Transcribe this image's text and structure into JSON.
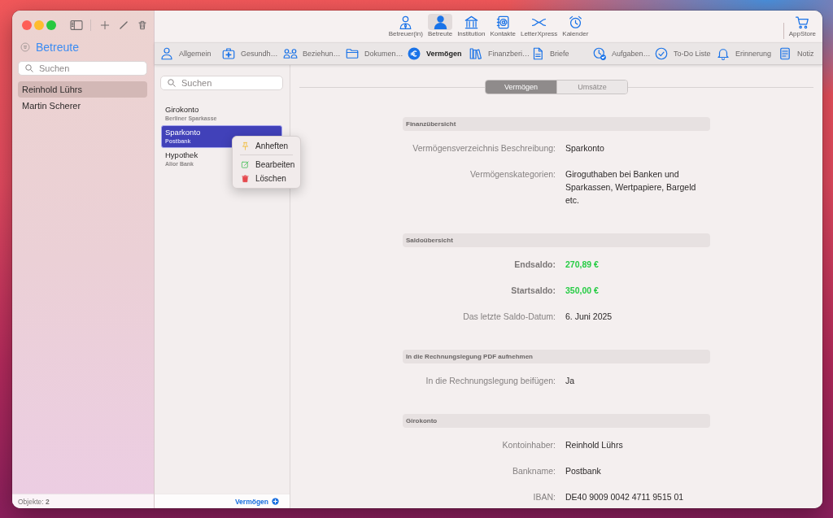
{
  "sidebar": {
    "title": "Betreute",
    "search": {
      "placeholder": "Suchen"
    },
    "items": [
      {
        "label": "Reinhold Lührs",
        "selected": true
      },
      {
        "label": "Martin Scherer",
        "selected": false
      }
    ],
    "footer": "Objekte: **2**"
  },
  "toolbar": {
    "items": [
      {
        "label": "Betreuer(in)",
        "selected": false
      },
      {
        "label": "Betreute",
        "selected": true
      },
      {
        "label": "Institution",
        "selected": false
      },
      {
        "label": "Kontakte",
        "selected": false
      },
      {
        "label": "LetterXpress",
        "selected": false
      },
      {
        "label": "Kalender",
        "selected": false
      }
    ],
    "store": {
      "label": "AppStore"
    }
  },
  "tabs": [
    {
      "label": "Allgemein",
      "selected": false
    },
    {
      "label": "Gesundh…",
      "selected": false
    },
    {
      "label": "Beziehun…",
      "selected": false
    },
    {
      "label": "Dokumen…",
      "selected": false
    },
    {
      "label": "Vermögen",
      "selected": true
    },
    {
      "label": "Finanzberi…",
      "selected": false
    },
    {
      "label": "Briefe",
      "selected": false
    },
    {
      "label": "Aufgaben…",
      "selected": false
    },
    {
      "label": "To-Do Liste",
      "selected": false
    },
    {
      "label": "Erinnerung",
      "selected": false
    },
    {
      "label": "Notiz",
      "selected": false
    }
  ],
  "list": {
    "search": {
      "placeholder": "Suchen"
    },
    "items": [
      {
        "title": "Girokonto",
        "subtitle": "Berliner Sparkasse",
        "selected": false
      },
      {
        "title": "Sparkonto",
        "subtitle": "Postbank",
        "selected": true
      },
      {
        "title": "Hypothek",
        "subtitle": "Alior Bank",
        "selected": false
      }
    ],
    "footer_button": "Vermögen"
  },
  "context_menu": {
    "items": [
      {
        "label": "Anheften",
        "separator_after": true
      },
      {
        "label": "Bearbeiten",
        "separator_after": false
      },
      {
        "label": "Löschen",
        "separator_after": false
      }
    ]
  },
  "segments": [
    {
      "label": "Vermögen",
      "selected": true
    },
    {
      "label": "Umsätze",
      "selected": false
    }
  ],
  "sections": [
    {
      "title": "Finanzübersicht",
      "rows": [
        {
          "label": "Vermögensverzeichnis Beschreibung:",
          "value": "Sparkonto",
          "kind": "text"
        },
        {
          "label": "Vermögenskategorien:",
          "value": "Giroguthaben bei Banken und Sparkassen, Wertpapiere, Bargeld etc.",
          "kind": "text"
        }
      ]
    },
    {
      "title": "Saldoübersicht",
      "rows": [
        {
          "label": "Endsaldo:",
          "value": "270,89 €",
          "kind": "amount"
        },
        {
          "label": "Startsaldo:",
          "value": "350,00 €",
          "kind": "amount"
        },
        {
          "label": "Das letzte Saldo-Datum:",
          "value": "6. Juni 2025",
          "kind": "text"
        }
      ]
    },
    {
      "title": "In die Rechnungslegung PDF aufnehmen",
      "rows": [
        {
          "label": "In die Rechnungslegung beifügen:",
          "value": "Ja",
          "kind": "text"
        }
      ]
    },
    {
      "title": "Girokonto",
      "rows": [
        {
          "label": "Kontoinhaber:",
          "value": "Reinhold Lührs",
          "kind": "text"
        },
        {
          "label": "Bankname:",
          "value": "Postbank",
          "kind": "text"
        },
        {
          "label": "IBAN:",
          "value": "DE40 9009 0042 4711 9515 01",
          "kind": "text"
        }
      ]
    }
  ]
}
